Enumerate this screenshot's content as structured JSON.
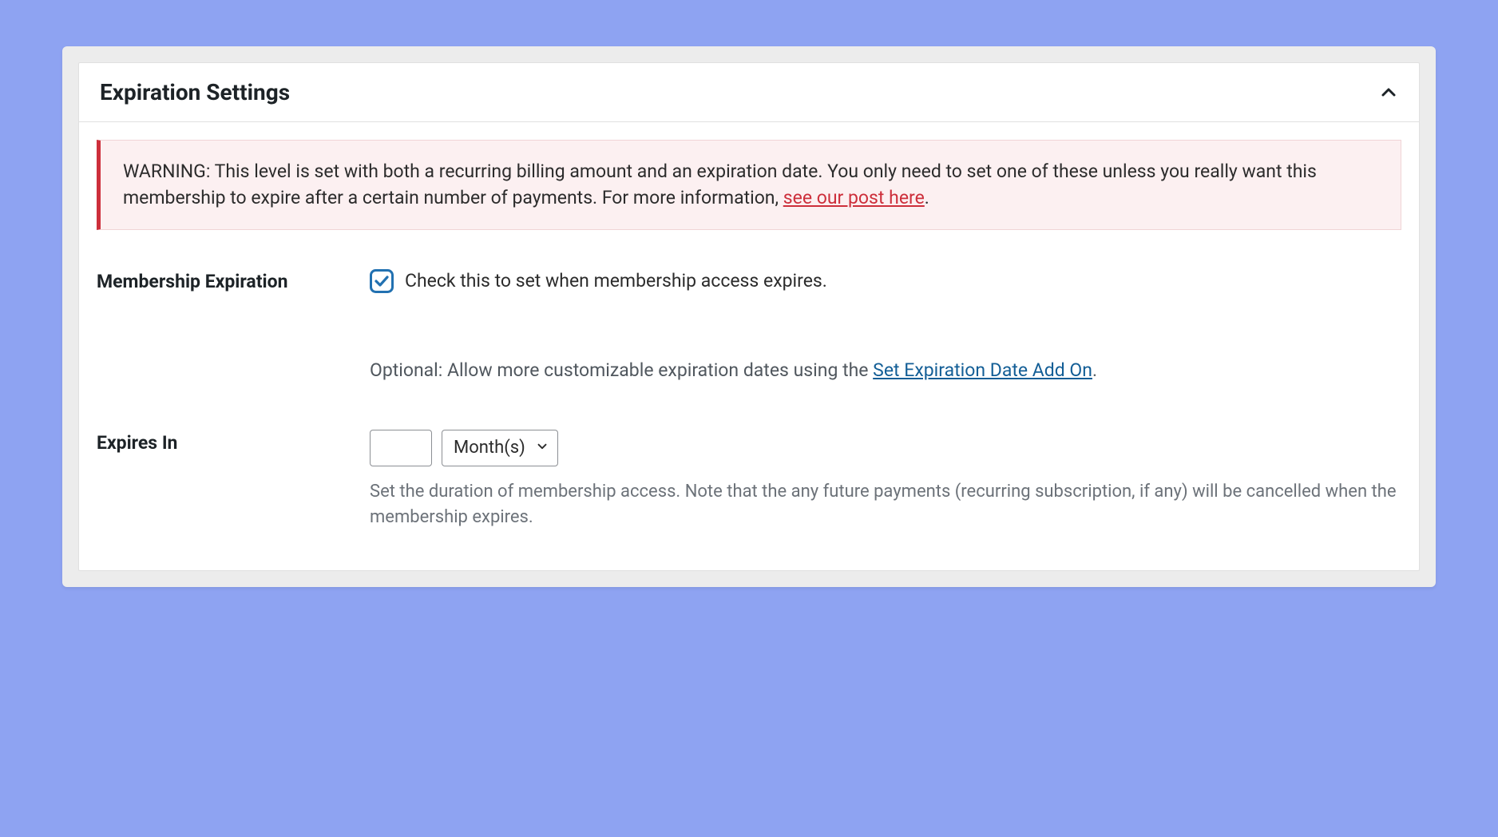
{
  "panel": {
    "title": "Expiration Settings"
  },
  "warning": {
    "prefix": "WARNING: This level is set with both a recurring billing amount and an expiration date. You only need to set one of these unless you really want this membership to expire after a certain number of payments. For more information, ",
    "link_text": "see our post here",
    "suffix": "."
  },
  "membership_expiration": {
    "label": "Membership Expiration",
    "checkbox_label": "Check this to set when membership access expires.",
    "checked": true,
    "optional_prefix": "Optional: Allow more customizable expiration dates using the ",
    "optional_link": "Set Expiration Date Add On",
    "optional_suffix": "."
  },
  "expires_in": {
    "label": "Expires In",
    "number_value": "",
    "unit_selected": "Month(s)",
    "help": "Set the duration of membership access. Note that the any future payments (recurring subscription, if any) will be cancelled when the membership expires."
  }
}
